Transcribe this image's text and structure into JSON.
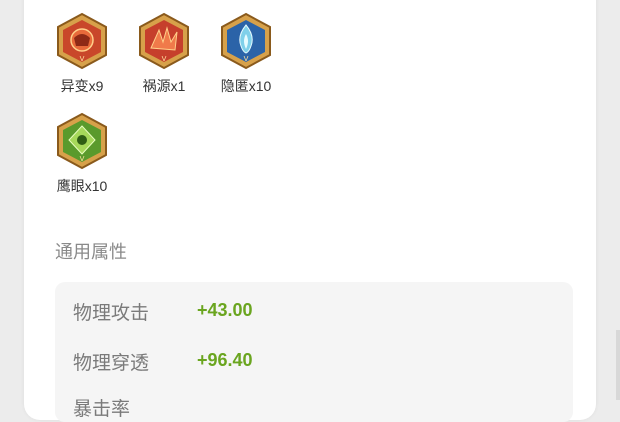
{
  "runes": [
    {
      "label": "异变x9",
      "icon": "red-mask-hexagon-rune-icon",
      "colors": {
        "fill": "#c9472a",
        "inner": "#e86a3a",
        "frame": "#d7a14a"
      }
    },
    {
      "label": "祸源x1",
      "icon": "red-claw-hexagon-rune-icon",
      "colors": {
        "fill": "#c63f2c",
        "inner": "#f07a4a",
        "frame": "#d7a14a"
      }
    },
    {
      "label": "隐匿x10",
      "icon": "blue-flame-hexagon-rune-icon",
      "colors": {
        "fill": "#2b63a8",
        "inner": "#7fd0ea",
        "frame": "#d7a14a"
      }
    },
    {
      "label": "鹰眼x10",
      "icon": "green-eye-hexagon-rune-icon",
      "colors": {
        "fill": "#5a9a2c",
        "inner": "#a6d85a",
        "frame": "#d7a14a"
      }
    }
  ],
  "section": {
    "title": "通用属性"
  },
  "attributes": [
    {
      "name": "物理攻击",
      "value": "+43.00"
    },
    {
      "name": "物理穿透",
      "value": "+96.40"
    },
    {
      "name": "暴击率",
      "value": ""
    }
  ],
  "accent_green": "#6aa51f"
}
